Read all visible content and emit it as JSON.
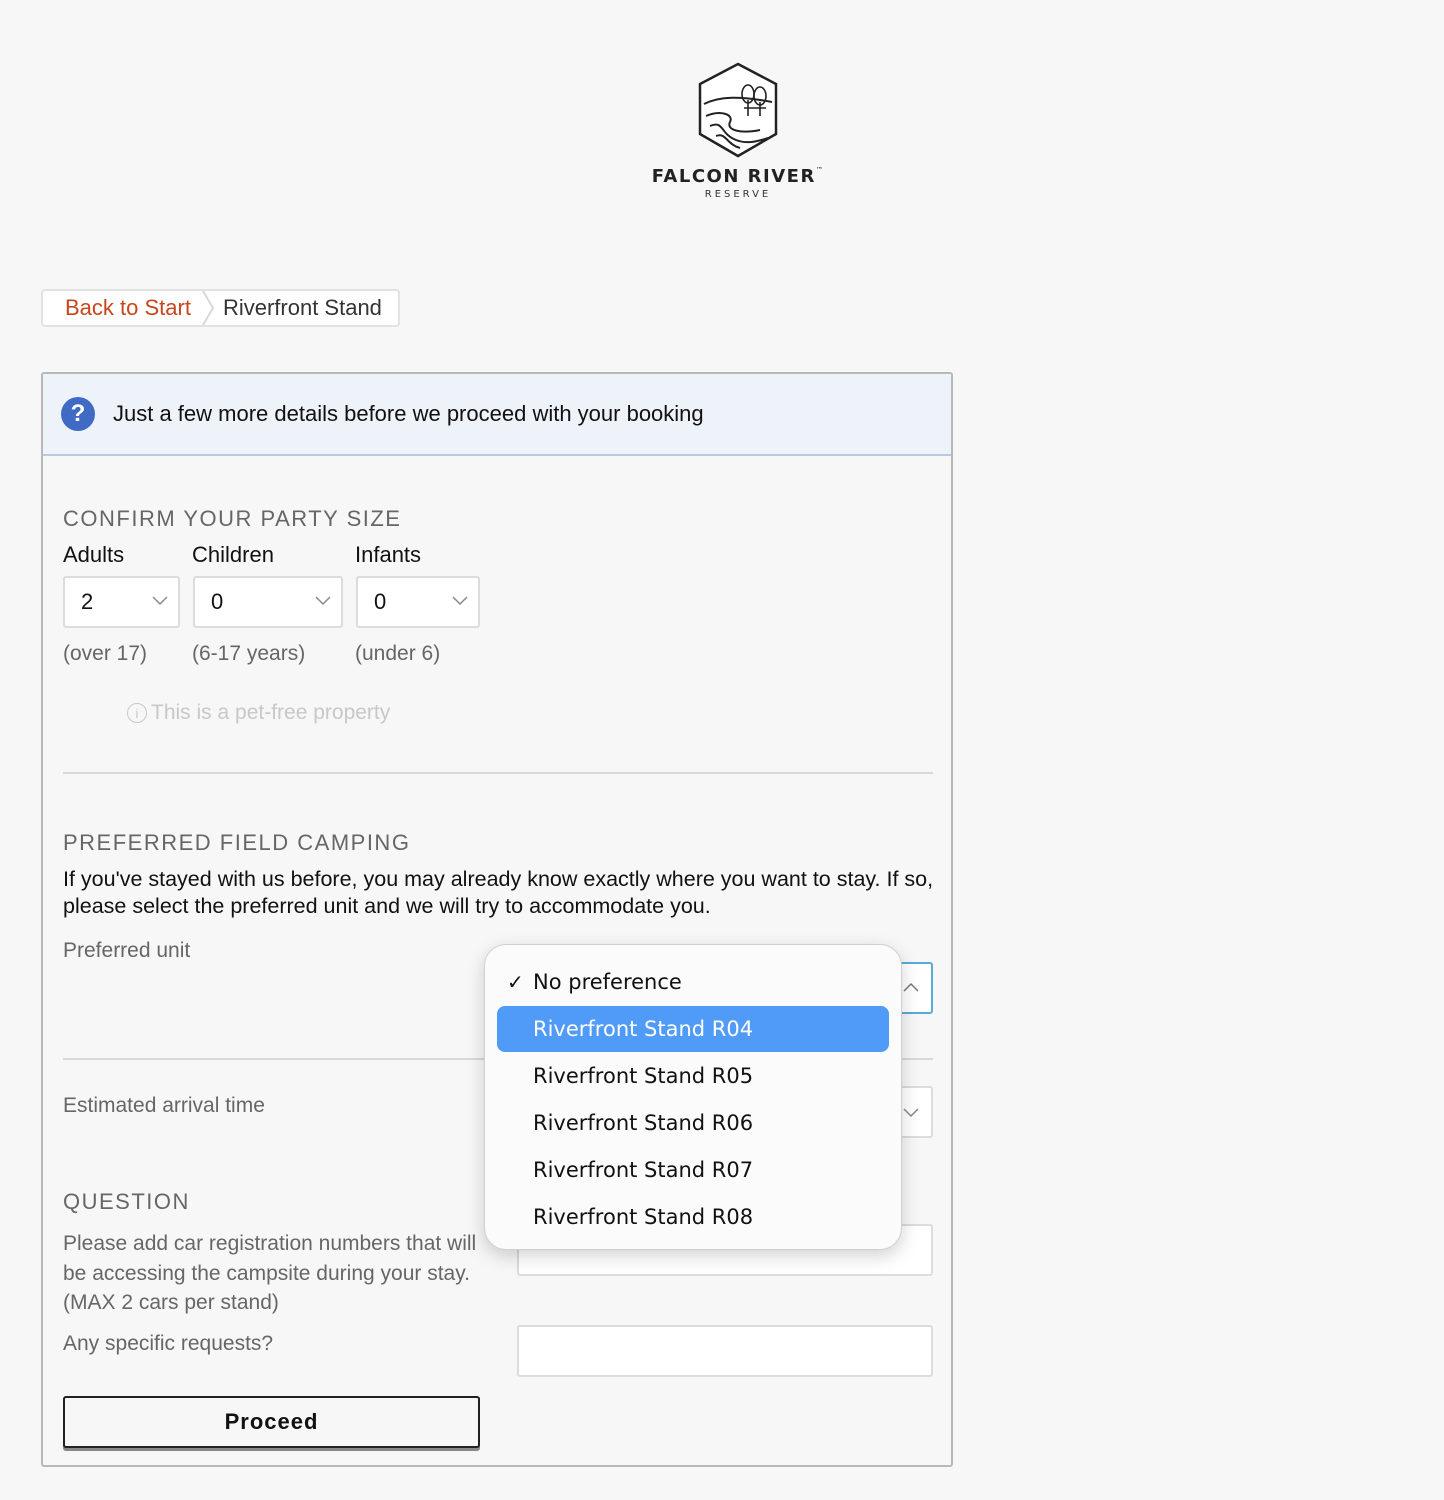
{
  "brand": {
    "name": "FALCON RIVER",
    "trademark": "™",
    "subtitle": "RESERVE"
  },
  "breadcrumb": {
    "back_label": "Back to Start",
    "current": "Riverfront Stand"
  },
  "header": {
    "message": "Just a few more details before we proceed with your booking",
    "icon": "question-icon"
  },
  "party": {
    "title": "CONFIRM YOUR PARTY SIZE",
    "adults": {
      "label": "Adults",
      "value": "2",
      "hint": "(over 17)"
    },
    "children": {
      "label": "Children",
      "value": "0",
      "hint": "(6-17 years)"
    },
    "infants": {
      "label": "Infants",
      "value": "0",
      "hint": "(under 6)"
    },
    "pet_note": "This is a pet-free property"
  },
  "camping": {
    "title": "PREFERRED FIELD CAMPING",
    "description": "If you've stayed with us before, you may already know exactly where you want to stay. If so, please select the preferred unit and we will try to accommodate you.",
    "unit_label": "Preferred unit"
  },
  "arrival": {
    "label": "Estimated arrival time"
  },
  "question": {
    "title": "QUESTION",
    "car_label": "Please add car registration numbers that will be accessing the campsite during your stay. (MAX 2 cars per stand)",
    "requests_label": "Any specific requests?"
  },
  "proceed_label": "Proceed",
  "dropdown": {
    "check": "✓",
    "options": [
      "No preference",
      "Riverfront Stand R04",
      "Riverfront Stand R05",
      "Riverfront Stand R06",
      "Riverfront Stand R07",
      "Riverfront Stand R08"
    ],
    "selected": "No preference",
    "highlighted": "Riverfront Stand R04"
  },
  "colors": {
    "accent_link": "#c8461c",
    "info_blue": "#3f6bc4",
    "highlight": "#4f9bf7",
    "header_bg": "#eef2f9"
  }
}
